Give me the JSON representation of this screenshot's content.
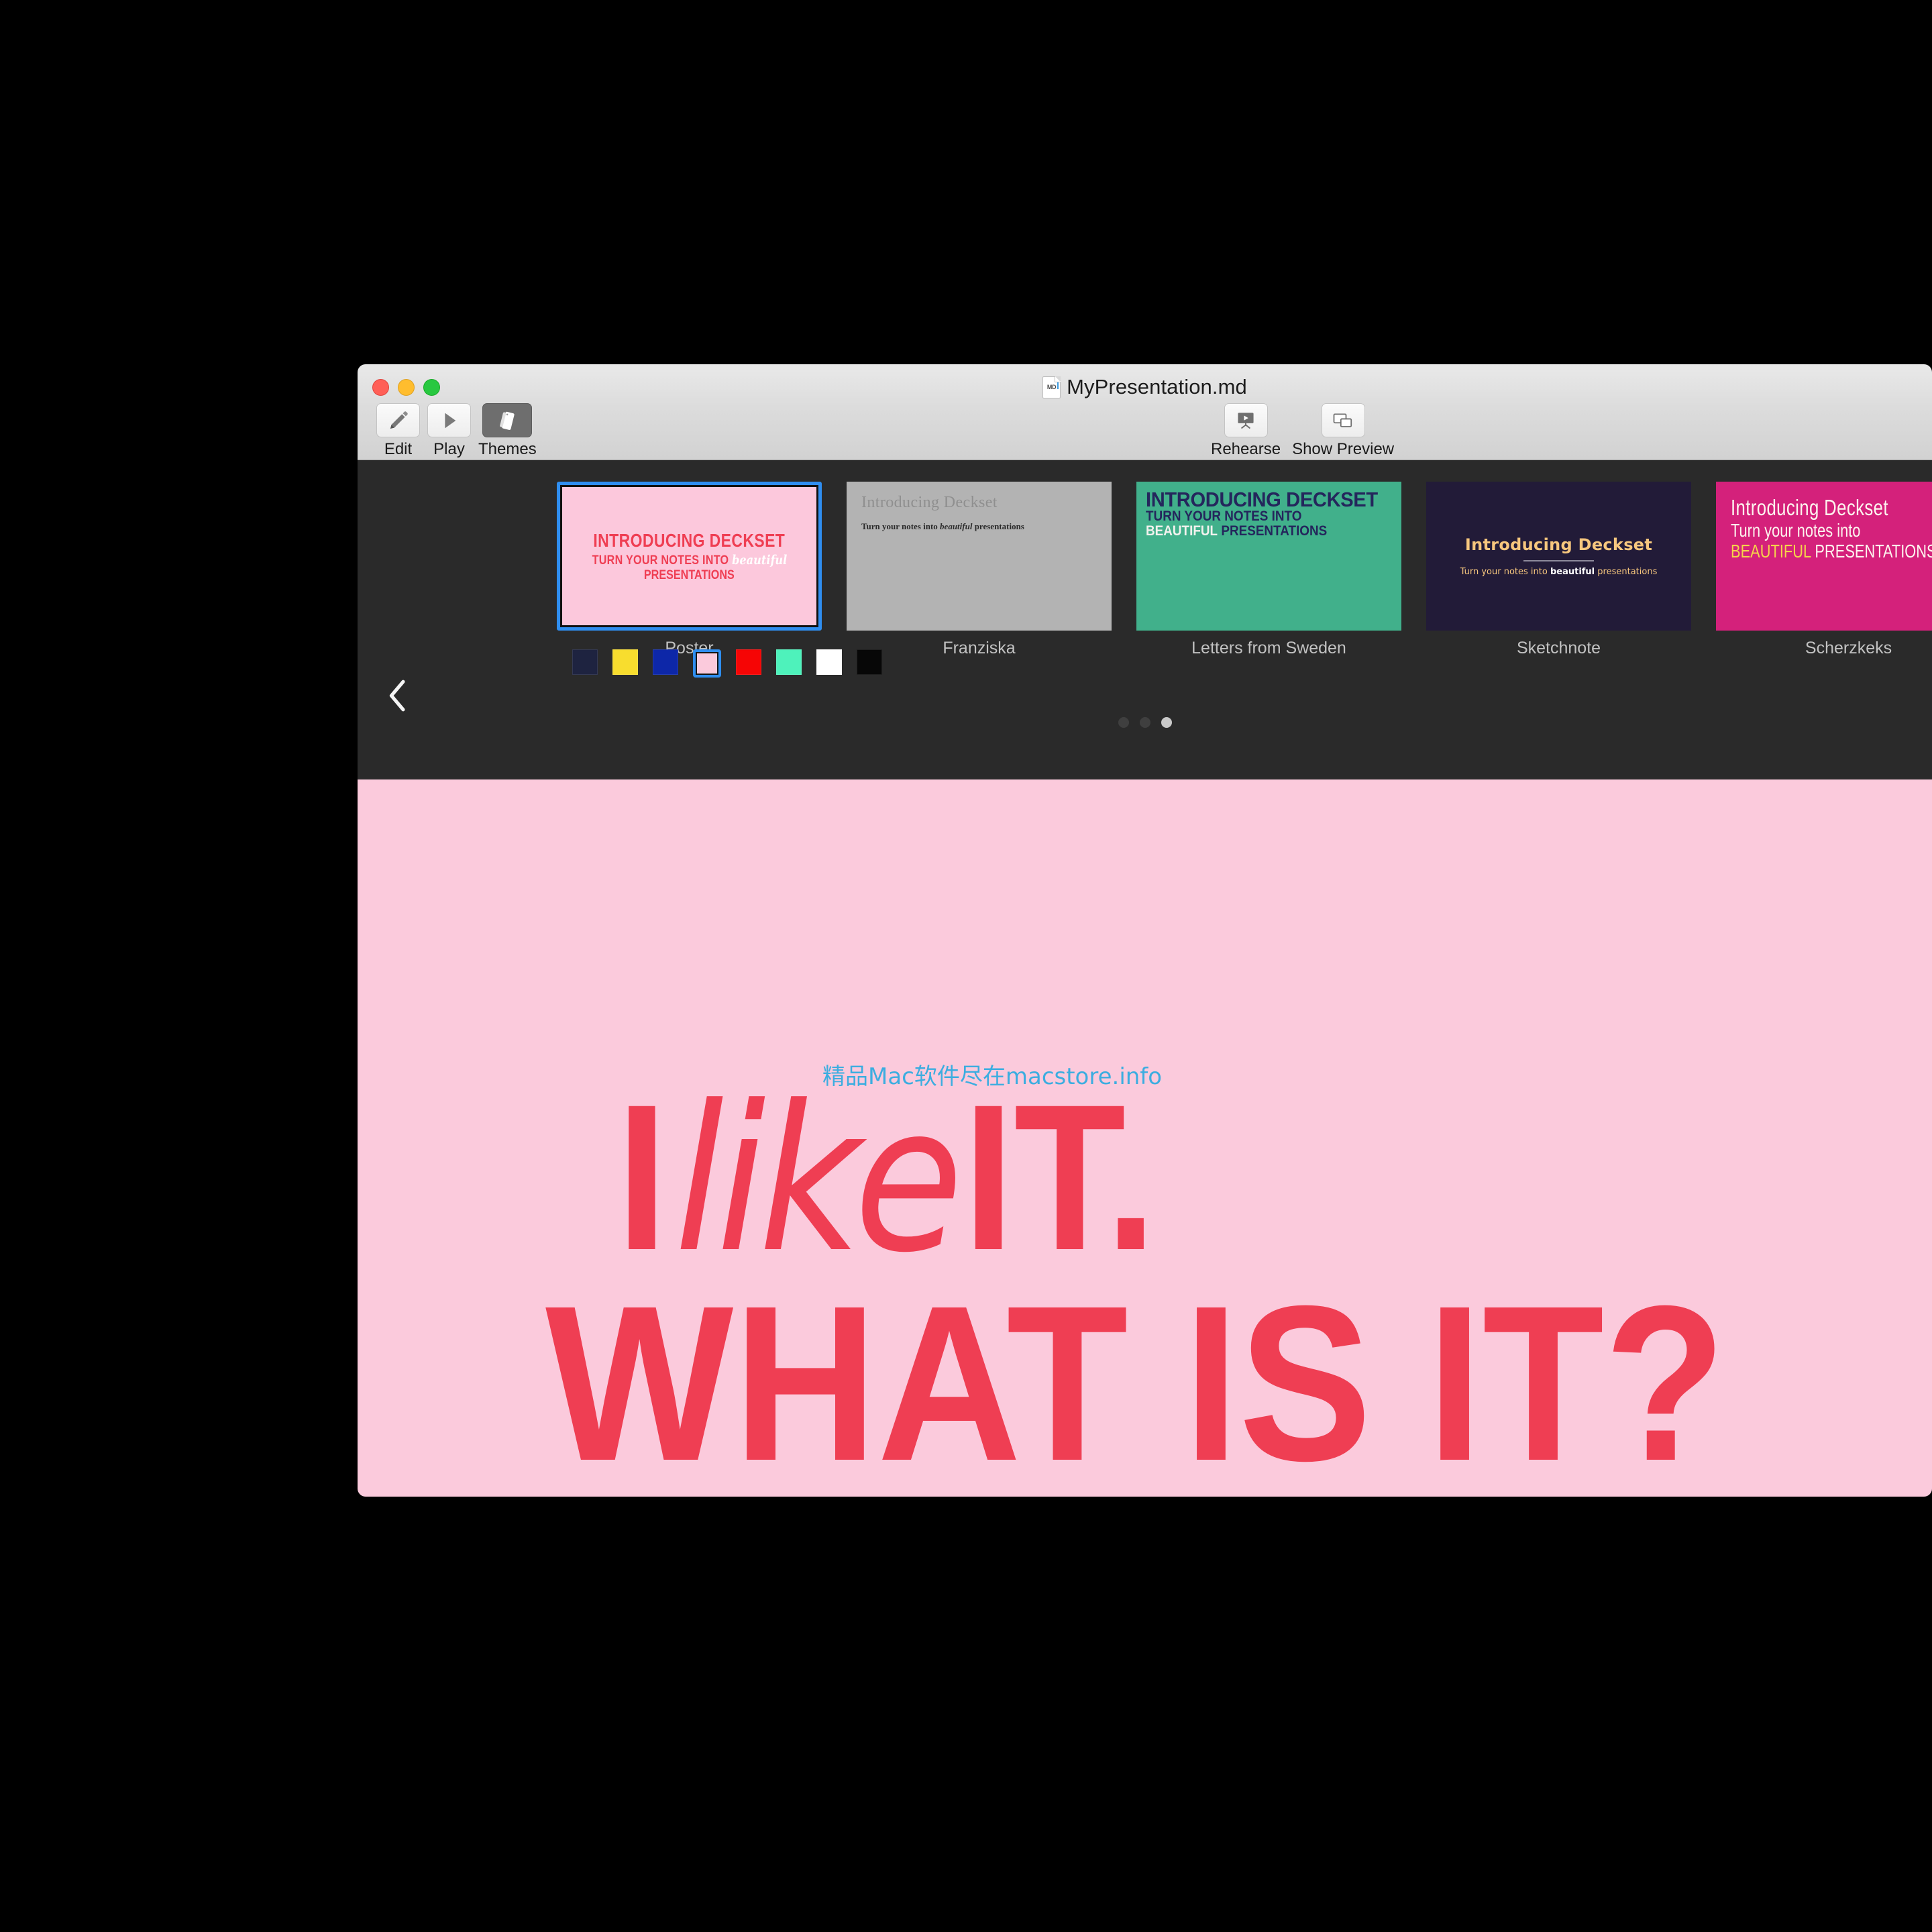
{
  "window": {
    "title": "MyPresentation.md",
    "doc_icon_label": "MD"
  },
  "toolbar": {
    "left_items": [
      {
        "label": "Edit",
        "icon": "pencil-icon",
        "active": false
      },
      {
        "label": "Play",
        "icon": "play-icon",
        "active": false
      },
      {
        "label": "Themes",
        "icon": "themes-icon",
        "active": true
      }
    ],
    "mid_items": [
      {
        "label": "Rehearse",
        "icon": "rehearse-icon"
      },
      {
        "label": "Show Preview",
        "icon": "preview-icon"
      }
    ]
  },
  "theme_picker": {
    "prev_arrow": "chevron-left-icon",
    "themes": [
      {
        "name": "Poster",
        "selected": true,
        "title": "INTRODUCING DECKSET",
        "sub_a": "TURN YOUR NOTES INTO",
        "sub_em": "beautiful",
        "sub_b": "PRESENTATIONS",
        "bg": "#fcc8dc",
        "fg": "#ef3e53"
      },
      {
        "name": "Franziska",
        "selected": false,
        "title": "Introducing Deckset",
        "sub_a": "Turn your notes into",
        "sub_em": "beautiful",
        "sub_b": "presentations",
        "bg": "#b3b3b3",
        "fg": "#8f8f8f"
      },
      {
        "name": "Letters from Sweden",
        "selected": false,
        "title": "INTRODUCING DECKSET",
        "sub_a": "TURN YOUR NOTES INTO",
        "sub_em": "BEAUTIFUL",
        "sub_b": "PRESENTATIONS",
        "bg": "#41b08b",
        "fg": "#24265c"
      },
      {
        "name": "Sketchnote",
        "selected": false,
        "title": "Introducing Deckset",
        "sub_a": "Turn your notes into",
        "sub_em": "beautiful",
        "sub_b": "presentations",
        "bg": "#221b38",
        "fg": "#f7c77e"
      },
      {
        "name": "Scherzkeks",
        "selected": false,
        "title": "Introducing Deckset",
        "sub_a": "Turn your notes into",
        "sub_em": "BEAUTIFUL",
        "sub_b": "PRESENTATIONS",
        "bg": "#d4217b",
        "fg": "#fdf4ee"
      }
    ],
    "swatches": [
      {
        "name": "midnight-navy",
        "color": "#1e2340",
        "selected": false
      },
      {
        "name": "yellow",
        "color": "#f8dd2e",
        "selected": false
      },
      {
        "name": "blue",
        "color": "#0d27a8",
        "selected": false
      },
      {
        "name": "pink",
        "color": "#fbcadc",
        "selected": true
      },
      {
        "name": "red",
        "color": "#f60505",
        "selected": false
      },
      {
        "name": "mint",
        "color": "#4ef2bb",
        "selected": false
      },
      {
        "name": "white",
        "color": "#ffffff",
        "selected": false
      },
      {
        "name": "black",
        "color": "#070707",
        "selected": false
      }
    ],
    "page_dots": [
      {
        "active": false
      },
      {
        "active": false
      },
      {
        "active": true
      }
    ]
  },
  "slide": {
    "background": "#fbcadc",
    "accent": "#ef3e53",
    "watermark": "精品Mac软件尽在macstore.info",
    "watermark_color": "#3cade0",
    "line1_a": "I",
    "line1_em": "like",
    "line1_b": "IT.",
    "line2": "WHAT IS IT?"
  }
}
